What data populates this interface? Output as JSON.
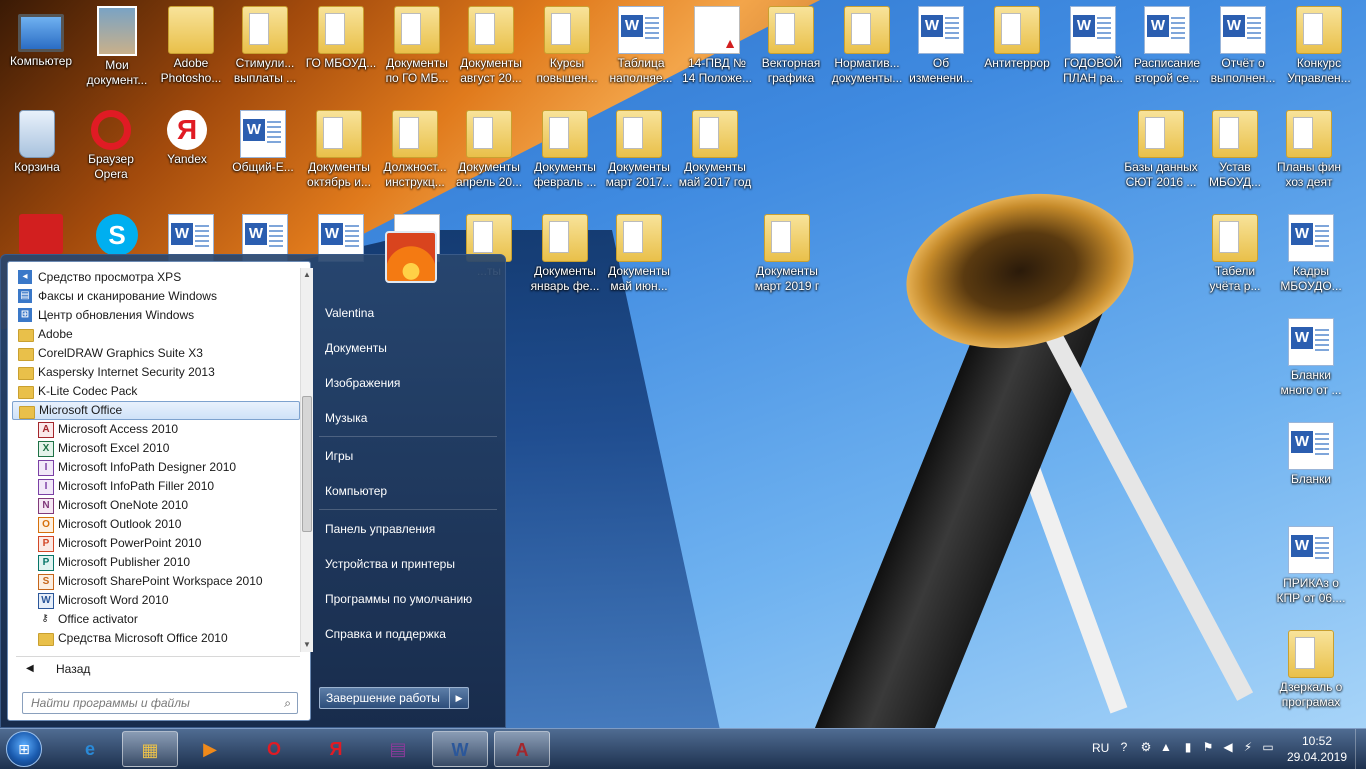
{
  "desktop": {
    "row1": [
      {
        "label": "Компьютер",
        "type": "computer"
      },
      {
        "label": "Мои документ...",
        "type": "photo"
      },
      {
        "label": "Adobe Photosho...",
        "type": "photoshop"
      },
      {
        "label": "Стимули... выплаты ...",
        "type": "folder"
      },
      {
        "label": "ГО МБОУД...",
        "type": "folder"
      },
      {
        "label": "Документы по ГО МБ...",
        "type": "folder"
      },
      {
        "label": "Документы август 20...",
        "type": "folder"
      },
      {
        "label": "Курсы повышен...",
        "type": "folder"
      },
      {
        "label": "Таблица наполняе...",
        "type": "word"
      },
      {
        "label": "14-ПВД № 14 Положе...",
        "type": "pdf"
      },
      {
        "label": "Векторная графика",
        "type": "folder"
      },
      {
        "label": "Норматив... документы...",
        "type": "folder"
      },
      {
        "label": "Об изменени...",
        "type": "word"
      },
      {
        "label": "Антитеррор",
        "type": "folder"
      },
      {
        "label": "ГОДОВОЙ ПЛАН ра...",
        "type": "word"
      },
      {
        "label": "Расписание второй се...",
        "type": "word"
      },
      {
        "label": "Отчёт о выполнен...",
        "type": "word"
      },
      {
        "label": "Конкурс Управлен...",
        "type": "folder"
      }
    ],
    "row2": [
      {
        "label": "Корзина",
        "type": "recycle"
      },
      {
        "label": "Браузер Opera",
        "type": "opera"
      },
      {
        "label": "Yandex",
        "type": "yandex"
      },
      {
        "label": "Общий-Е...",
        "type": "word"
      },
      {
        "label": "Документы октябрь и...",
        "type": "folder"
      },
      {
        "label": "Должност... инструкц...",
        "type": "folder"
      },
      {
        "label": "Документы апрель 20...",
        "type": "folder"
      },
      {
        "label": "Документы февраль ...",
        "type": "folder"
      },
      {
        "label": "Документы март 2017...",
        "type": "folder"
      },
      {
        "label": "Документы май 2017 год",
        "type": "folder"
      }
    ],
    "row2_right": [
      {
        "label": "Базы данных СЮТ  2016 ...",
        "type": "folder"
      },
      {
        "label": "Устав МБОУД...",
        "type": "folder"
      },
      {
        "label": "Планы фин хоз деят",
        "type": "folder"
      }
    ],
    "row3_mid": [
      {
        "label": "...ты",
        "type": "folder"
      },
      {
        "label": "Документы январь фе...",
        "type": "folder"
      },
      {
        "label": "Документы май июн...",
        "type": "folder"
      }
    ],
    "row3_extra": {
      "label": "Документы март 2019 г",
      "type": "folder"
    },
    "right_col": [
      {
        "label": "Табели учёта р...",
        "type": "folder"
      },
      {
        "label": "Кадры МБОУДО...",
        "type": "word"
      },
      {
        "label": "Бланки много от ...",
        "type": "word"
      },
      {
        "label": "Бланки",
        "type": "word"
      },
      {
        "label": "ПРИКАз о КПР от 06....",
        "type": "word"
      },
      {
        "label": "Дзеркаль о програмах",
        "type": "folder"
      }
    ]
  },
  "start_menu": {
    "programs": [
      {
        "label": "Средство просмотра XPS",
        "sub": false,
        "icon": "blue",
        "glyph": "◂"
      },
      {
        "label": "Факсы и сканирование Windows",
        "sub": false,
        "icon": "blue",
        "glyph": "▤"
      },
      {
        "label": "Центр обновления Windows",
        "sub": false,
        "icon": "blue",
        "glyph": "⊞"
      },
      {
        "label": "Adobe",
        "sub": false,
        "icon": "fold",
        "glyph": ""
      },
      {
        "label": "CorelDRAW Graphics Suite X3",
        "sub": false,
        "icon": "fold",
        "glyph": ""
      },
      {
        "label": "Kaspersky Internet Security 2013",
        "sub": false,
        "icon": "fold",
        "glyph": ""
      },
      {
        "label": "K-Lite Codec Pack",
        "sub": false,
        "icon": "fold",
        "glyph": ""
      },
      {
        "label": "Microsoft Office",
        "sub": false,
        "icon": "fold",
        "glyph": "",
        "selected": true
      },
      {
        "label": "Microsoft Access 2010",
        "sub": true,
        "icon": "access",
        "glyph": "A"
      },
      {
        "label": "Microsoft Excel 2010",
        "sub": true,
        "icon": "excel",
        "glyph": "X"
      },
      {
        "label": "Microsoft InfoPath Designer 2010",
        "sub": true,
        "icon": "infopath",
        "glyph": "I"
      },
      {
        "label": "Microsoft InfoPath Filler 2010",
        "sub": true,
        "icon": "infopath",
        "glyph": "I"
      },
      {
        "label": "Microsoft OneNote 2010",
        "sub": true,
        "icon": "onenote",
        "glyph": "N"
      },
      {
        "label": "Microsoft Outlook 2010",
        "sub": true,
        "icon": "outlook",
        "glyph": "O"
      },
      {
        "label": "Microsoft PowerPoint 2010",
        "sub": true,
        "icon": "ppt",
        "glyph": "P"
      },
      {
        "label": "Microsoft Publisher 2010",
        "sub": true,
        "icon": "pub",
        "glyph": "P"
      },
      {
        "label": "Microsoft SharePoint Workspace 2010",
        "sub": true,
        "icon": "sp",
        "glyph": "S"
      },
      {
        "label": "Microsoft Word 2010",
        "sub": true,
        "icon": "word",
        "glyph": "W"
      },
      {
        "label": "Office activator",
        "sub": true,
        "icon": "key",
        "glyph": "⚷"
      },
      {
        "label": "Средства Microsoft Office 2010",
        "sub": true,
        "icon": "fold",
        "glyph": ""
      }
    ],
    "back_label": "Назад",
    "search_placeholder": "Найти программы и файлы",
    "right_items": [
      "Valentina",
      "Документы",
      "Изображения",
      "Музыка",
      "Игры",
      "Компьютер",
      "Панель управления",
      "Устройства и принтеры",
      "Программы по умолчанию",
      "Справка и поддержка"
    ],
    "shutdown_label": "Завершение работы"
  },
  "taskbar": {
    "buttons": [
      {
        "name": "internet-explorer",
        "glyph": "e",
        "color": "#2a8ad8"
      },
      {
        "name": "windows-explorer",
        "glyph": "▦",
        "color": "#e9c04a",
        "active": true
      },
      {
        "name": "media-player",
        "glyph": "▶",
        "color": "#f08a1a"
      },
      {
        "name": "opera",
        "glyph": "O",
        "color": "#e01b24"
      },
      {
        "name": "yandex",
        "glyph": "Я",
        "color": "#e01b24"
      },
      {
        "name": "winrar",
        "glyph": "▤",
        "color": "#8a3b9a"
      },
      {
        "name": "word",
        "glyph": "W",
        "color": "#2b579a",
        "active": true
      },
      {
        "name": "access",
        "glyph": "A",
        "color": "#a4262c",
        "active": true
      }
    ],
    "lang": "RU",
    "time": "10:52",
    "date": "29.04.2019"
  }
}
